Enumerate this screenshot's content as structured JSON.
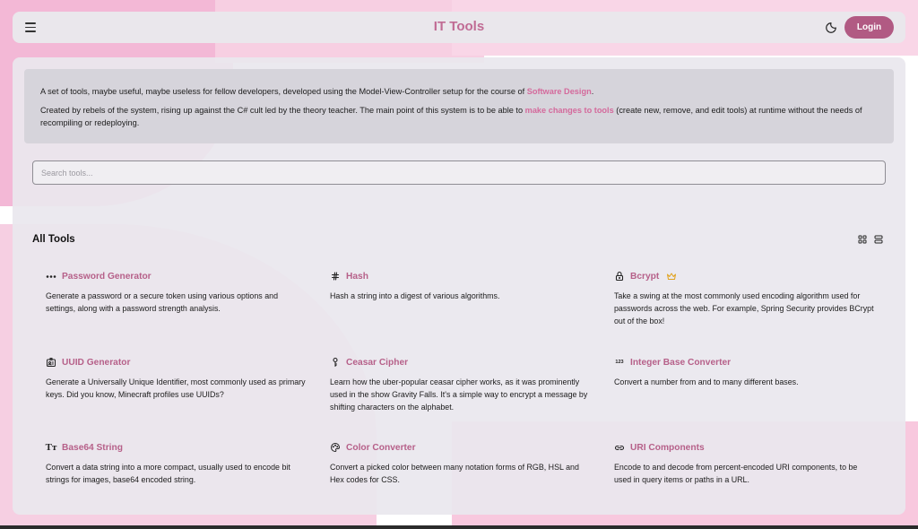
{
  "header": {
    "title": "IT Tools",
    "login_label": "Login"
  },
  "info": {
    "p1_text": "A set of tools, maybe useful, maybe useless for fellow developers, developed using the Model-View-Controller setup for the course of ",
    "p1_link": "Software Design",
    "p1_end": ".",
    "p2_text": "Created by rebels of the system, rising up against the C# cult led by the theory teacher. The main point of this system is to be able to ",
    "p2_link": "make changes to tools",
    "p2_end": " (create new, remove, and edit tools) at runtime without the needs of recompiling or redeploying."
  },
  "search": {
    "placeholder": "Search tools..."
  },
  "section": {
    "title": "All Tools"
  },
  "tools": [
    {
      "name": "Password Generator",
      "icon": "dots-icon",
      "desc": "Generate a password or a secure token using various options and settings, along with a password strength analysis."
    },
    {
      "name": "Hash",
      "icon": "hash-icon",
      "desc": "Hash a string into a digest of various algorithms."
    },
    {
      "name": "Bcrypt",
      "icon": "lock-icon",
      "premium": "crown-icon",
      "desc": "Take a swing at the most commonly used encoding algorithm used for passwords across the web. For example, Spring Security provides BCrypt out of the box!"
    },
    {
      "name": "UUID Generator",
      "icon": "id-icon",
      "desc": "Generate a Universally Unique Identifier, most commonly used as primary keys. Did you know, Minecraft profiles use UUIDs?"
    },
    {
      "name": "Ceasar Cipher",
      "icon": "key-icon",
      "desc": "Learn how the uber-popular ceasar cipher works, as it was prominently used in the show Gravity Falls. It's a simple way to encrypt a message by shifting characters on the alphabet."
    },
    {
      "name": "Integer Base Converter",
      "icon": "numbers-icon",
      "icon_text": "123",
      "desc": "Convert a number from and to many different bases."
    },
    {
      "name": "Base64 String",
      "icon": "typography-icon",
      "icon_text": "Tт",
      "desc": "Convert a data string into a more compact, usually used to encode bit strings for images, base64 encoded string."
    },
    {
      "name": "Color Converter",
      "icon": "palette-icon",
      "desc": "Convert a picked color between many notation forms of RGB, HSL and Hex codes for CSS."
    },
    {
      "name": "URI Components",
      "icon": "link-icon",
      "desc": "Encode to and decode from percent-encoded URI components, to be used in query items or paths in a URL."
    }
  ],
  "colors": {
    "accent": "#b66089",
    "login_bg": "#b15a83",
    "title": "#c06b94",
    "link": "#d46a9c",
    "crown": "#e0a21c"
  }
}
